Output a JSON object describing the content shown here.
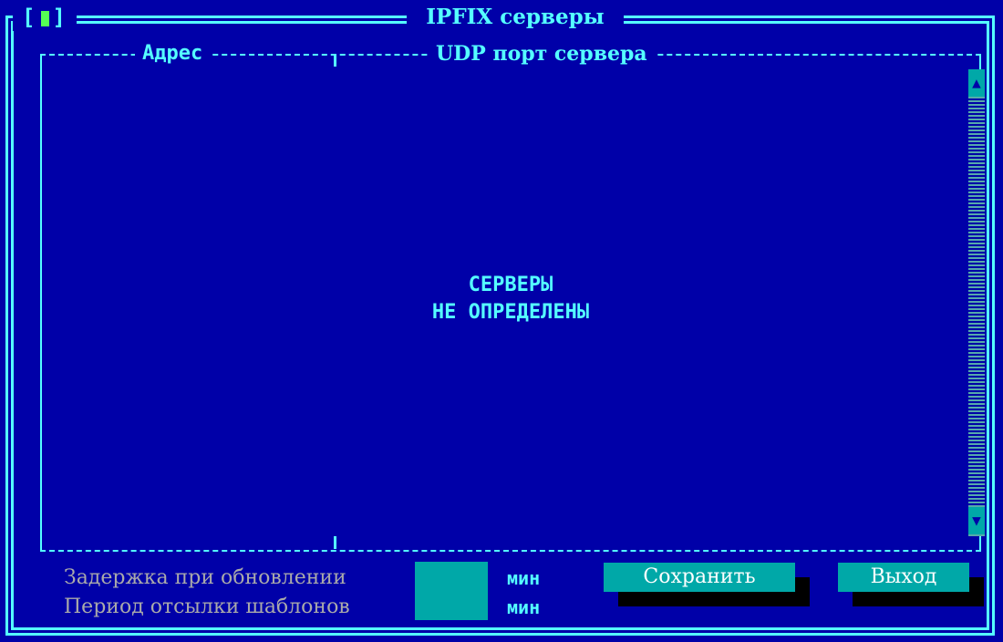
{
  "window": {
    "title": "IPFIX серверы",
    "close_label": "[▮]"
  },
  "list": {
    "columns": [
      {
        "label": "Адрес"
      },
      {
        "label": "UDP порт сервера"
      }
    ],
    "empty_line1": "СЕРВЕРЫ",
    "empty_line2": "НЕ ОПРЕДЕЛЕНЫ",
    "scroll_up_icon": "arrow-up-icon",
    "scroll_down_icon": "arrow-down-icon"
  },
  "form": {
    "delay_label": "Задержка при обновлении",
    "delay_value": "",
    "delay_unit": "мин",
    "period_label": "Период отсылки шаблонов",
    "period_value": "",
    "period_unit": "мин"
  },
  "buttons": {
    "save_label": "Сохранить",
    "exit_label": "Выход"
  },
  "colors": {
    "background": "#0000a8",
    "frame": "#55ffff",
    "accent": "#00a8a8",
    "label": "#aaaaaa"
  }
}
